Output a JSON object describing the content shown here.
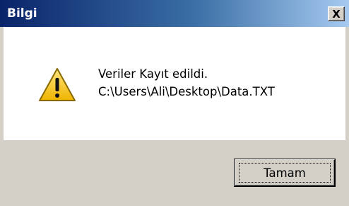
{
  "window": {
    "title": "Bilgi",
    "close_label": "X"
  },
  "message": {
    "line1": "Veriler Kayıt edildi.",
    "line2": "C:\\Users\\Ali\\Desktop\\Data.TXT",
    "icon": "warning-icon"
  },
  "buttons": {
    "ok_label": "Tamam"
  },
  "colors": {
    "titlebar_start": "#0a246a",
    "titlebar_end": "#a6caf0",
    "dialog_face": "#d4d0c8",
    "warning_yellow": "#f5c400"
  }
}
